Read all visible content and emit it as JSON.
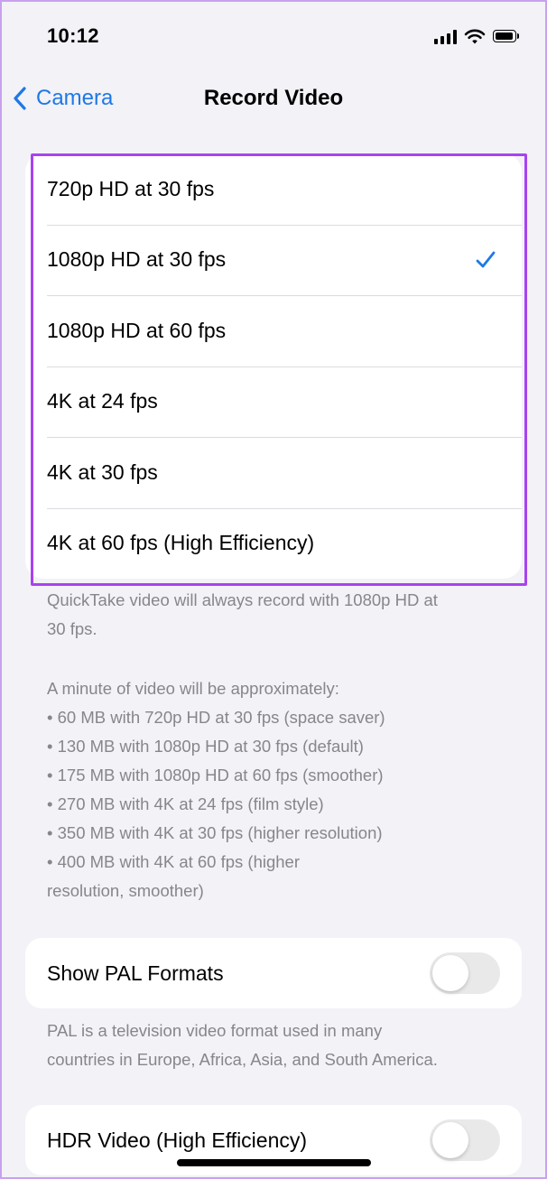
{
  "status_bar": {
    "time": "10:12"
  },
  "nav": {
    "back_label": "Camera",
    "title": "Record Video"
  },
  "options": [
    {
      "label": "720p HD at 30 fps",
      "selected": false
    },
    {
      "label": "1080p HD at 30 fps",
      "selected": true
    },
    {
      "label": "1080p HD at 60 fps",
      "selected": false
    },
    {
      "label": "4K at 24 fps",
      "selected": false
    },
    {
      "label": "4K at 30 fps",
      "selected": false
    },
    {
      "label": "4K at 60 fps (High Efficiency)",
      "selected": false
    }
  ],
  "quicktake_note": {
    "line1": "QuickTake video will always record with 1080p HD at",
    "line2": "30 fps."
  },
  "size_note": {
    "intro": "A minute of video will be approximately:",
    "items": [
      "• 60 MB with 720p HD at 30 fps (space saver)",
      "• 130 MB with 1080p HD at 30 fps (default)",
      "• 175 MB with 1080p HD at 60 fps (smoother)",
      "• 270 MB with 4K at 24 fps (film style)",
      "• 350 MB with 4K at 30 fps (higher resolution)",
      "• 400 MB with 4K at 60 fps (higher",
      "resolution, smoother)"
    ]
  },
  "pal": {
    "label": "Show PAL Formats",
    "enabled": false,
    "note_line1": "PAL is a television video format used in many",
    "note_line2": "countries in Europe, Africa, Asia, and South America."
  },
  "hdr": {
    "label": "HDR Video (High Efficiency)",
    "enabled": false
  },
  "colors": {
    "accent": "#1f78e6",
    "highlight_border": "#a843f0",
    "background": "#f2f2f7",
    "footnote_text": "#86868b",
    "toggle_off": "#e9e9ea"
  }
}
